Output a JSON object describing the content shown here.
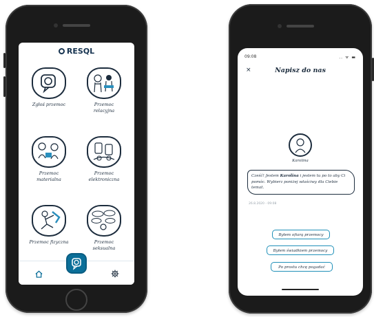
{
  "left_app": {
    "logo": "RESQL",
    "tiles": [
      {
        "label": "Zgłoś przemoc",
        "icon": "report-chat-icon"
      },
      {
        "label": "Przemoc relacyjna",
        "icon": "relational-violence-illustration"
      },
      {
        "label": "Przemoc materialna",
        "icon": "material-violence-illustration"
      },
      {
        "label": "Przemoc elektroniczna",
        "icon": "electronic-violence-illustration"
      },
      {
        "label": "Przemoc fizyczna",
        "icon": "physical-violence-illustration"
      },
      {
        "label": "Przemoc seksualna",
        "icon": "sexual-violence-illustration"
      }
    ],
    "nav": {
      "home": "home-icon",
      "center": "chat-icon",
      "settings": "gear-icon"
    }
  },
  "right_app": {
    "status_time": "09:08",
    "status_icons": ".. ᯤ ▬",
    "close_glyph": "×",
    "title": "Napisz do nas",
    "avatar_name": "Karolina",
    "message_parts": {
      "before": "Cześć! Jestem ",
      "name": "Karolina",
      "after": " i jestem tu po to aby Ci pomóc. Wybierz poniżej właściwy dla Ciebie temat."
    },
    "timestamp": "26.8.2020 - 09:08",
    "options": [
      "Byłem ofiarą przemocy",
      "Byłem świadkiem przemocy",
      "Po prostu chcę pogadać"
    ]
  },
  "colors": {
    "accent": "#0b6f99",
    "ink": "#1c2c3d",
    "option_border": "#1e8fb8",
    "phone": "#1b1b1b"
  }
}
